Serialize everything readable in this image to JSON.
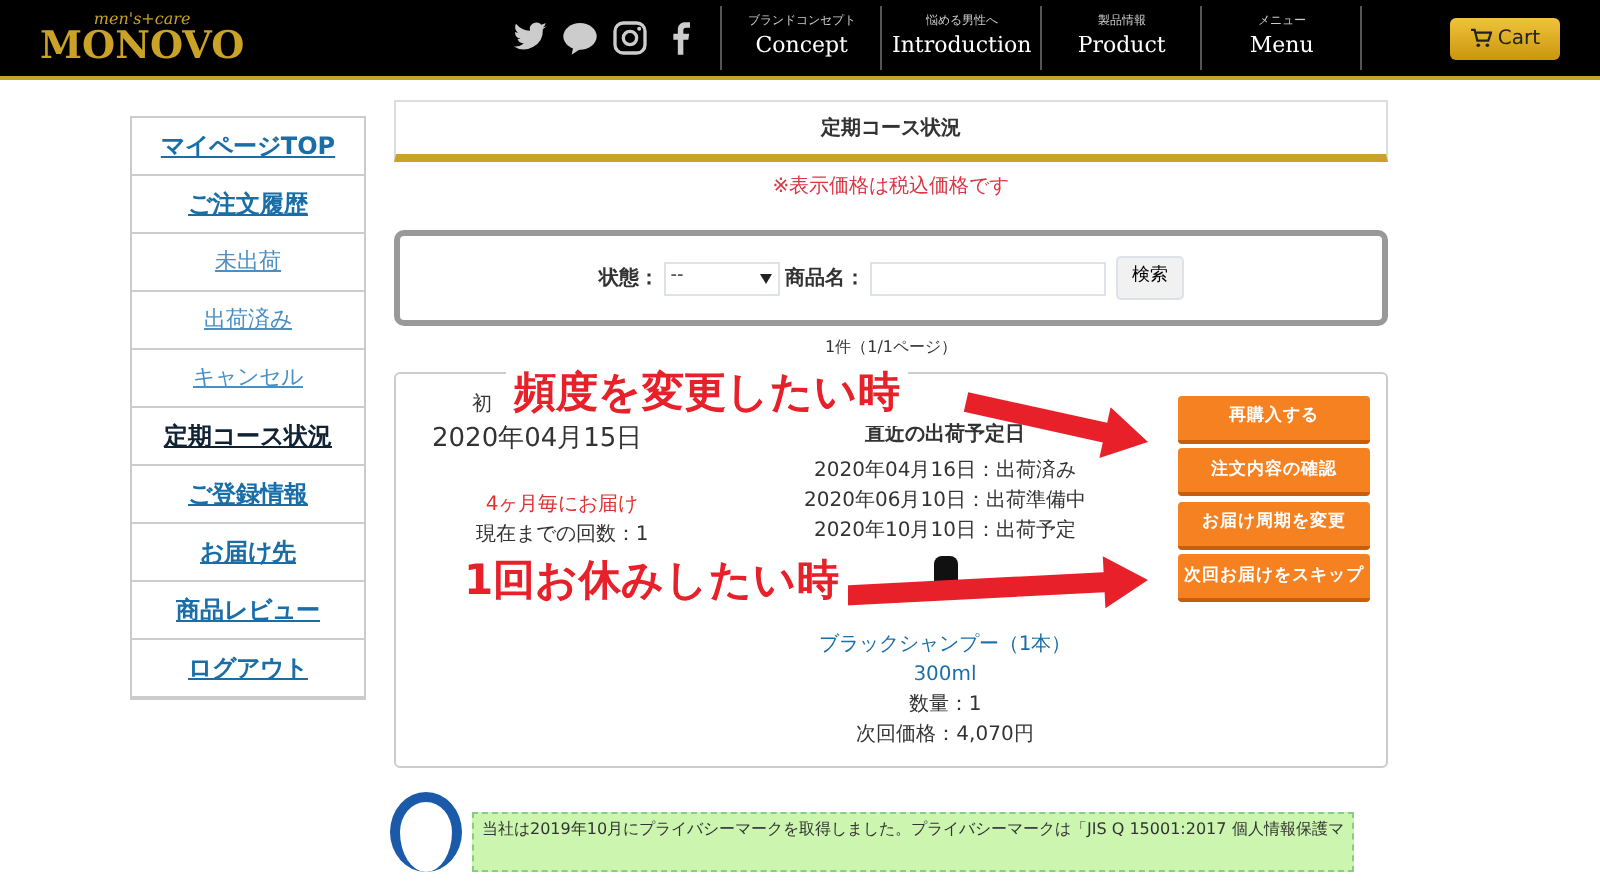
{
  "header": {
    "logo_tagline": "men's+care",
    "logo": "MONOVO",
    "nav": [
      {
        "sub": "ブランドコンセプト",
        "label": "Concept"
      },
      {
        "sub": "悩める男性へ",
        "label": "Introduction"
      },
      {
        "sub": "製品情報",
        "label": "Product"
      },
      {
        "sub": "メニュー",
        "label": "Menu"
      }
    ],
    "cart": "Cart"
  },
  "sidebar": {
    "items": [
      {
        "label": "マイページTOP",
        "kind": "main",
        "selected": false
      },
      {
        "label": "ご注文履歴",
        "kind": "main",
        "selected": false
      },
      {
        "label": "未出荷",
        "kind": "sub",
        "selected": false
      },
      {
        "label": "出荷済み",
        "kind": "sub",
        "selected": false
      },
      {
        "label": "キャンセル",
        "kind": "sub",
        "selected": false
      },
      {
        "label": "定期コース状況",
        "kind": "main",
        "selected": true
      },
      {
        "label": "ご登録情報",
        "kind": "main",
        "selected": false
      },
      {
        "label": "お届け先",
        "kind": "main",
        "selected": false
      },
      {
        "label": "商品レビュー",
        "kind": "main",
        "selected": false
      },
      {
        "label": "ログアウト",
        "kind": "main",
        "selected": false
      }
    ]
  },
  "page_title": "定期コース状況",
  "notice": "※表示価格は税込価格です",
  "search": {
    "status_label": "状態：",
    "status_value": "--",
    "product_label": "商品名：",
    "button": "検索"
  },
  "count": "1件（1/1ページ）",
  "order": {
    "first_label": "初",
    "date": "2020年04月15日",
    "frequency": "4ヶ月毎にお届け",
    "times": "現在までの回数：1",
    "schedule_title": "直近の出荷予定日",
    "schedule": [
      "2020年04月16日：出荷済み",
      "2020年06月10日：出荷準備中",
      "2020年10月10日：出荷予定"
    ],
    "product_name": "ブラックシャンプー（1本）300ml",
    "quantity": "数量：1",
    "price": "次回価格：4,070円",
    "buttons": [
      "再購入する",
      "注文内容の確認",
      "お届け周期を変更",
      "次回お届けをスキップ"
    ]
  },
  "annotations": [
    {
      "text": "頻度を変更したい時"
    },
    {
      "text": "1回お休みしたい時"
    }
  ],
  "footer": {
    "privacy_text": "当社は2019年10月にプライバシーマークを取得しました。プライバシーマークは「JIS Q 15001:2017 個人情報保護マ"
  }
}
